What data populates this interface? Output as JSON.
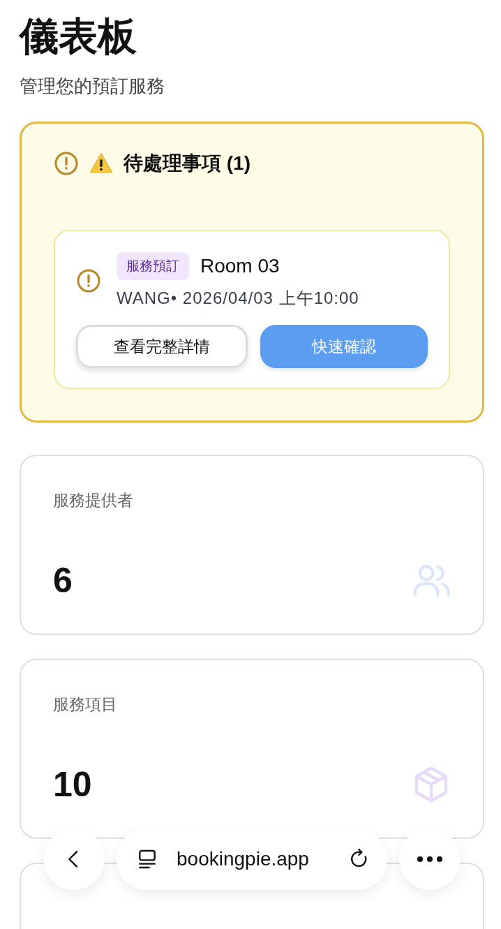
{
  "page": {
    "title": "儀表板",
    "subtitle": "管理您的預訂服務"
  },
  "pending": {
    "title": "待處理事項 (1)",
    "items": [
      {
        "tag": "服務預訂",
        "name": "Room 03",
        "meta": "WANG• 2026/04/03 上午10:00",
        "buttons": [
          {
            "label": "查看完整詳情",
            "kind": "secondary"
          },
          {
            "label": "快速確認",
            "kind": "primary"
          }
        ]
      }
    ]
  },
  "stats": [
    {
      "label": "服務提供者",
      "value": "6"
    },
    {
      "label": "服務項目",
      "value": "10"
    }
  ],
  "browser_bar": {
    "url": "bookingpie.app"
  }
}
